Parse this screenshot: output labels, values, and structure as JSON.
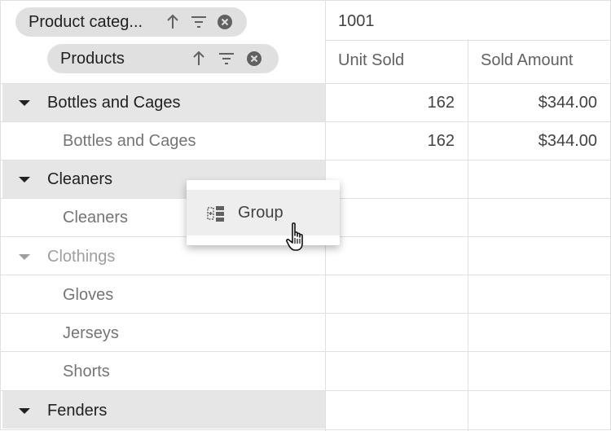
{
  "row_headers": {
    "chips": [
      {
        "label": "Product categ..."
      },
      {
        "label": "Products"
      }
    ],
    "rows": [
      {
        "label": "Bottles and Cages",
        "kind": "group",
        "expanded": true
      },
      {
        "label": "Bottles and Cages",
        "kind": "child"
      },
      {
        "label": "Cleaners",
        "kind": "group",
        "expanded": true
      },
      {
        "label": "Cleaners",
        "kind": "child"
      },
      {
        "label": "Clothings",
        "kind": "group-dim",
        "expanded": true
      },
      {
        "label": "Gloves",
        "kind": "child"
      },
      {
        "label": "Jerseys",
        "kind": "child"
      },
      {
        "label": "Shorts",
        "kind": "child"
      },
      {
        "label": "Fenders",
        "kind": "group",
        "expanded": true
      }
    ]
  },
  "column_header": {
    "top_label": "1001",
    "columns": [
      "Unit Sold",
      "Sold Amount"
    ]
  },
  "values": [
    [
      "162",
      "$344.00"
    ],
    [
      "162",
      "$344.00"
    ]
  ],
  "context_menu": {
    "item_label": "Group",
    "item_icon": "group-icon"
  },
  "colors": {
    "chip_bg": "#e0e0e0",
    "group_row_bg": "#e6e6e6",
    "border": "#e0e0e0"
  }
}
